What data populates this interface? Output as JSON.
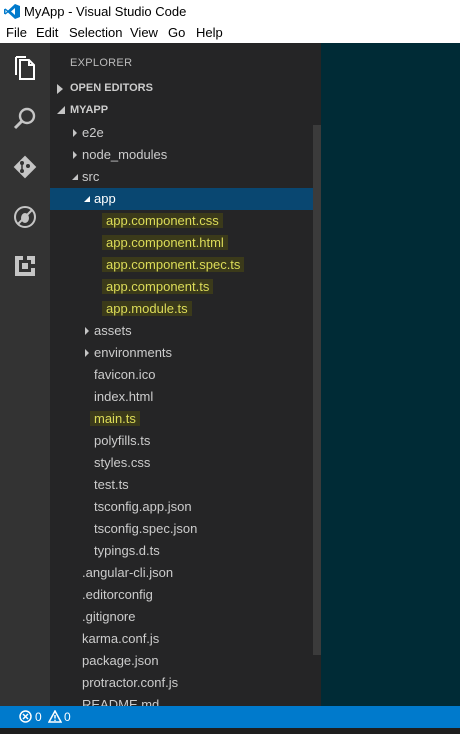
{
  "window": {
    "title": "MyApp - Visual Studio Code"
  },
  "menu": {
    "items": [
      "File",
      "Edit",
      "Selection",
      "View",
      "Go",
      "Help"
    ]
  },
  "activity_bar": {
    "icons": [
      "explorer-icon",
      "search-icon",
      "source-control-icon",
      "debug-icon",
      "extensions-icon"
    ]
  },
  "sidebar": {
    "title": "EXPLORER",
    "open_editors": "OPEN EDITORS",
    "project": "MYAPP",
    "tree": [
      {
        "name": "e2e",
        "type": "folder",
        "expanded": false,
        "highlighted": false,
        "selected": false
      },
      {
        "name": "node_modules",
        "type": "folder",
        "expanded": false,
        "highlighted": false,
        "selected": false
      },
      {
        "name": "src",
        "type": "folder",
        "expanded": true,
        "highlighted": false,
        "selected": false
      },
      {
        "name": "app",
        "type": "folder",
        "expanded": true,
        "highlighted": false,
        "selected": true
      },
      {
        "name": "app.component.css",
        "type": "file",
        "highlighted": true,
        "selected": false
      },
      {
        "name": "app.component.html",
        "type": "file",
        "highlighted": true,
        "selected": false
      },
      {
        "name": "app.component.spec.ts",
        "type": "file",
        "highlighted": true,
        "selected": false
      },
      {
        "name": "app.component.ts",
        "type": "file",
        "highlighted": true,
        "selected": false
      },
      {
        "name": "app.module.ts",
        "type": "file",
        "highlighted": true,
        "selected": false
      },
      {
        "name": "assets",
        "type": "folder",
        "expanded": false,
        "highlighted": false,
        "selected": false
      },
      {
        "name": "environments",
        "type": "folder",
        "expanded": false,
        "highlighted": false,
        "selected": false
      },
      {
        "name": "favicon.ico",
        "type": "file",
        "highlighted": false,
        "selected": false
      },
      {
        "name": "index.html",
        "type": "file",
        "highlighted": false,
        "selected": false
      },
      {
        "name": "main.ts",
        "type": "file",
        "highlighted": true,
        "selected": false
      },
      {
        "name": "polyfills.ts",
        "type": "file",
        "highlighted": false,
        "selected": false
      },
      {
        "name": "styles.css",
        "type": "file",
        "highlighted": false,
        "selected": false
      },
      {
        "name": "test.ts",
        "type": "file",
        "highlighted": false,
        "selected": false
      },
      {
        "name": "tsconfig.app.json",
        "type": "file",
        "highlighted": false,
        "selected": false
      },
      {
        "name": "tsconfig.spec.json",
        "type": "file",
        "highlighted": false,
        "selected": false
      },
      {
        "name": "typings.d.ts",
        "type": "file",
        "highlighted": false,
        "selected": false
      },
      {
        "name": ".angular-cli.json",
        "type": "file",
        "highlighted": false,
        "selected": false
      },
      {
        "name": ".editorconfig",
        "type": "file",
        "highlighted": false,
        "selected": false
      },
      {
        "name": ".gitignore",
        "type": "file",
        "highlighted": false,
        "selected": false
      },
      {
        "name": "karma.conf.js",
        "type": "file",
        "highlighted": false,
        "selected": false
      },
      {
        "name": "package.json",
        "type": "file",
        "highlighted": false,
        "selected": false
      },
      {
        "name": "protractor.conf.js",
        "type": "file",
        "highlighted": false,
        "selected": false
      },
      {
        "name": "README.md",
        "type": "file",
        "highlighted": false,
        "selected": false
      }
    ]
  },
  "status_bar": {
    "errors": "0",
    "warnings": "0"
  },
  "colors": {
    "activity_bar": "#333333",
    "sidebar": "#252526",
    "editor": "#002b36",
    "status_bar": "#007acc",
    "selection": "#094771",
    "highlight_text": "#dcdc58"
  }
}
